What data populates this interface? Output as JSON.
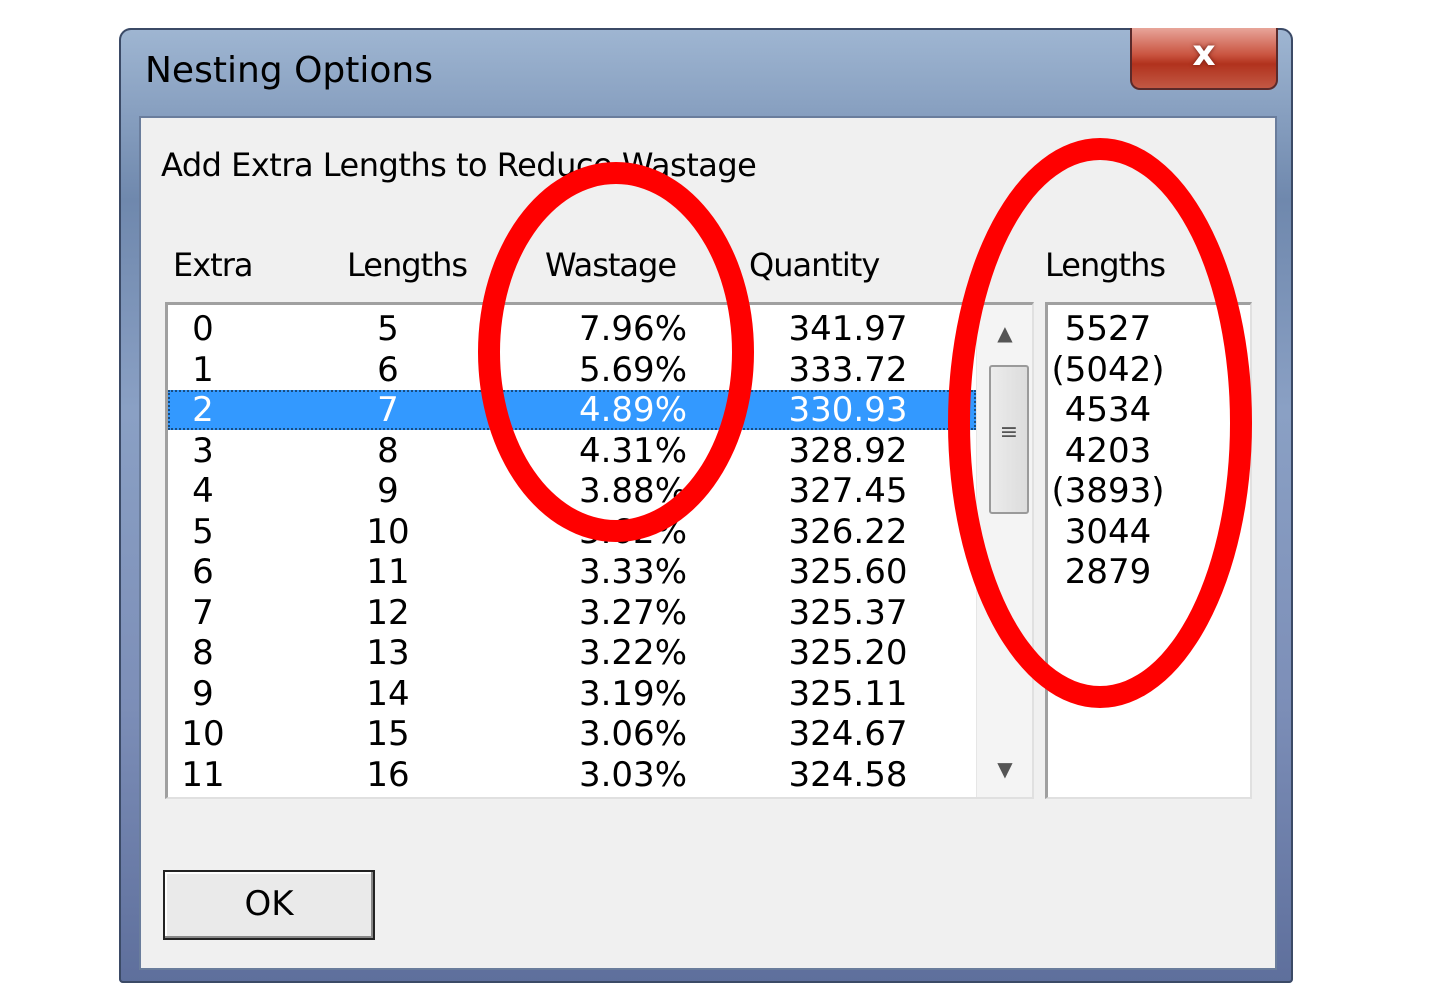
{
  "window": {
    "title": "Nesting Options",
    "close_glyph": "x"
  },
  "heading": "Add Extra Lengths to Reduce Wastage",
  "columns": {
    "extra": "Extra",
    "lengths": "Lengths",
    "wastage": "Wastage",
    "quantity": "Quantity",
    "lengths_list": "Lengths"
  },
  "rows": [
    {
      "extra": "0",
      "lengths": "5",
      "wastage": "7.96%",
      "quantity": "341.97"
    },
    {
      "extra": "1",
      "lengths": "6",
      "wastage": "5.69%",
      "quantity": "333.72"
    },
    {
      "extra": "2",
      "lengths": "7",
      "wastage": "4.89%",
      "quantity": "330.93"
    },
    {
      "extra": "3",
      "lengths": "8",
      "wastage": "4.31%",
      "quantity": "328.92"
    },
    {
      "extra": "4",
      "lengths": "9",
      "wastage": "3.88%",
      "quantity": "327.45"
    },
    {
      "extra": "5",
      "lengths": "10",
      "wastage": "3.62%",
      "quantity": "326.22"
    },
    {
      "extra": "6",
      "lengths": "11",
      "wastage": "3.33%",
      "quantity": "325.60"
    },
    {
      "extra": "7",
      "lengths": "12",
      "wastage": "3.27%",
      "quantity": "325.37"
    },
    {
      "extra": "8",
      "lengths": "13",
      "wastage": "3.22%",
      "quantity": "325.20"
    },
    {
      "extra": "9",
      "lengths": "14",
      "wastage": "3.19%",
      "quantity": "325.11"
    },
    {
      "extra": "10",
      "lengths": "15",
      "wastage": "3.06%",
      "quantity": "324.67"
    },
    {
      "extra": "11",
      "lengths": "16",
      "wastage": "3.03%",
      "quantity": "324.58"
    }
  ],
  "selected_row": 2,
  "lengths_list": [
    "5527",
    "(5042)",
    "4534",
    "4203",
    "(3893)",
    "3044",
    "2879"
  ],
  "ok_label": "OK",
  "annotation_color": "#ff0000",
  "selection_color": "#3399ff"
}
